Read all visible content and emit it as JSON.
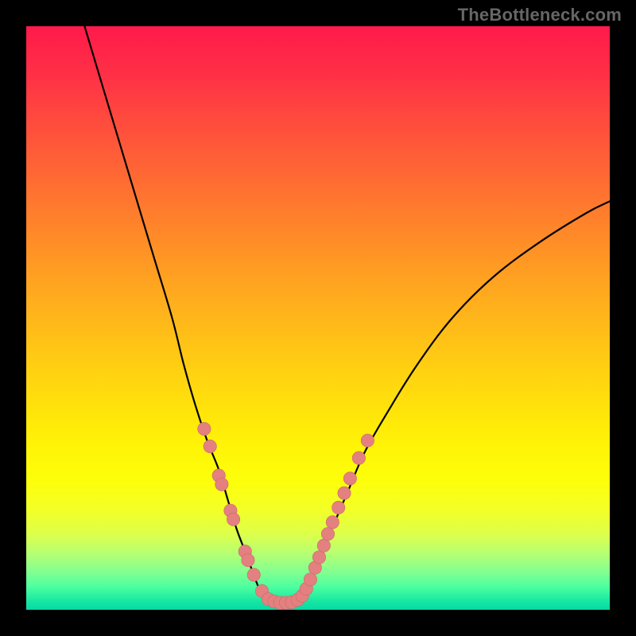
{
  "watermark": {
    "text": "TheBottleneck.com"
  },
  "colors": {
    "curve": "#000000",
    "marker_fill": "#e48080",
    "marker_stroke": "#c76b6b",
    "background_top": "#ff1a4a",
    "background_bottom": "#08d8a4"
  },
  "chart_data": {
    "type": "line",
    "title": "",
    "xlabel": "",
    "ylabel": "",
    "xlim": [
      0,
      100
    ],
    "ylim": [
      0,
      100
    ],
    "grid": false,
    "legend": false,
    "series": [
      {
        "name": "left-arm",
        "x": [
          10,
          13,
          16,
          19,
          22,
          25,
          27,
          29,
          31,
          33,
          34.5,
          36,
          37.5,
          38.8,
          40,
          41.5
        ],
        "values": [
          100,
          90,
          80,
          70,
          60,
          50,
          42,
          35,
          29,
          24,
          19,
          14,
          10,
          6.5,
          3.5,
          1.5
        ]
      },
      {
        "name": "valley-floor",
        "x": [
          41.5,
          43,
          44.5,
          46,
          47
        ],
        "values": [
          1.5,
          1.2,
          1.2,
          1.3,
          1.5
        ]
      },
      {
        "name": "right-arm",
        "x": [
          47,
          48.5,
          50,
          52,
          55,
          58,
          62,
          67,
          73,
          80,
          88,
          96,
          100
        ],
        "values": [
          1.5,
          4,
          8,
          13,
          20,
          27,
          34,
          42,
          50,
          57,
          63,
          68,
          70
        ]
      }
    ],
    "markers": {
      "name": "highlighted-points",
      "points": [
        {
          "x": 30.5,
          "y": 31
        },
        {
          "x": 31.5,
          "y": 28
        },
        {
          "x": 33,
          "y": 23
        },
        {
          "x": 33.5,
          "y": 21.5
        },
        {
          "x": 35,
          "y": 17
        },
        {
          "x": 35.5,
          "y": 15.5
        },
        {
          "x": 37.5,
          "y": 10
        },
        {
          "x": 38,
          "y": 8.5
        },
        {
          "x": 39,
          "y": 6
        },
        {
          "x": 40.4,
          "y": 3.2
        },
        {
          "x": 41.5,
          "y": 1.8
        },
        {
          "x": 42.5,
          "y": 1.4
        },
        {
          "x": 43.5,
          "y": 1.2
        },
        {
          "x": 44.5,
          "y": 1.2
        },
        {
          "x": 45.5,
          "y": 1.3
        },
        {
          "x": 46.5,
          "y": 1.7
        },
        {
          "x": 47.3,
          "y": 2.4
        },
        {
          "x": 48,
          "y": 3.6
        },
        {
          "x": 48.7,
          "y": 5.2
        },
        {
          "x": 49.5,
          "y": 7.2
        },
        {
          "x": 50.2,
          "y": 9
        },
        {
          "x": 51,
          "y": 11
        },
        {
          "x": 51.7,
          "y": 13
        },
        {
          "x": 52.5,
          "y": 15
        },
        {
          "x": 53.5,
          "y": 17.5
        },
        {
          "x": 54.5,
          "y": 20
        },
        {
          "x": 55.5,
          "y": 22.5
        },
        {
          "x": 57,
          "y": 26
        },
        {
          "x": 58.5,
          "y": 29
        }
      ]
    }
  }
}
